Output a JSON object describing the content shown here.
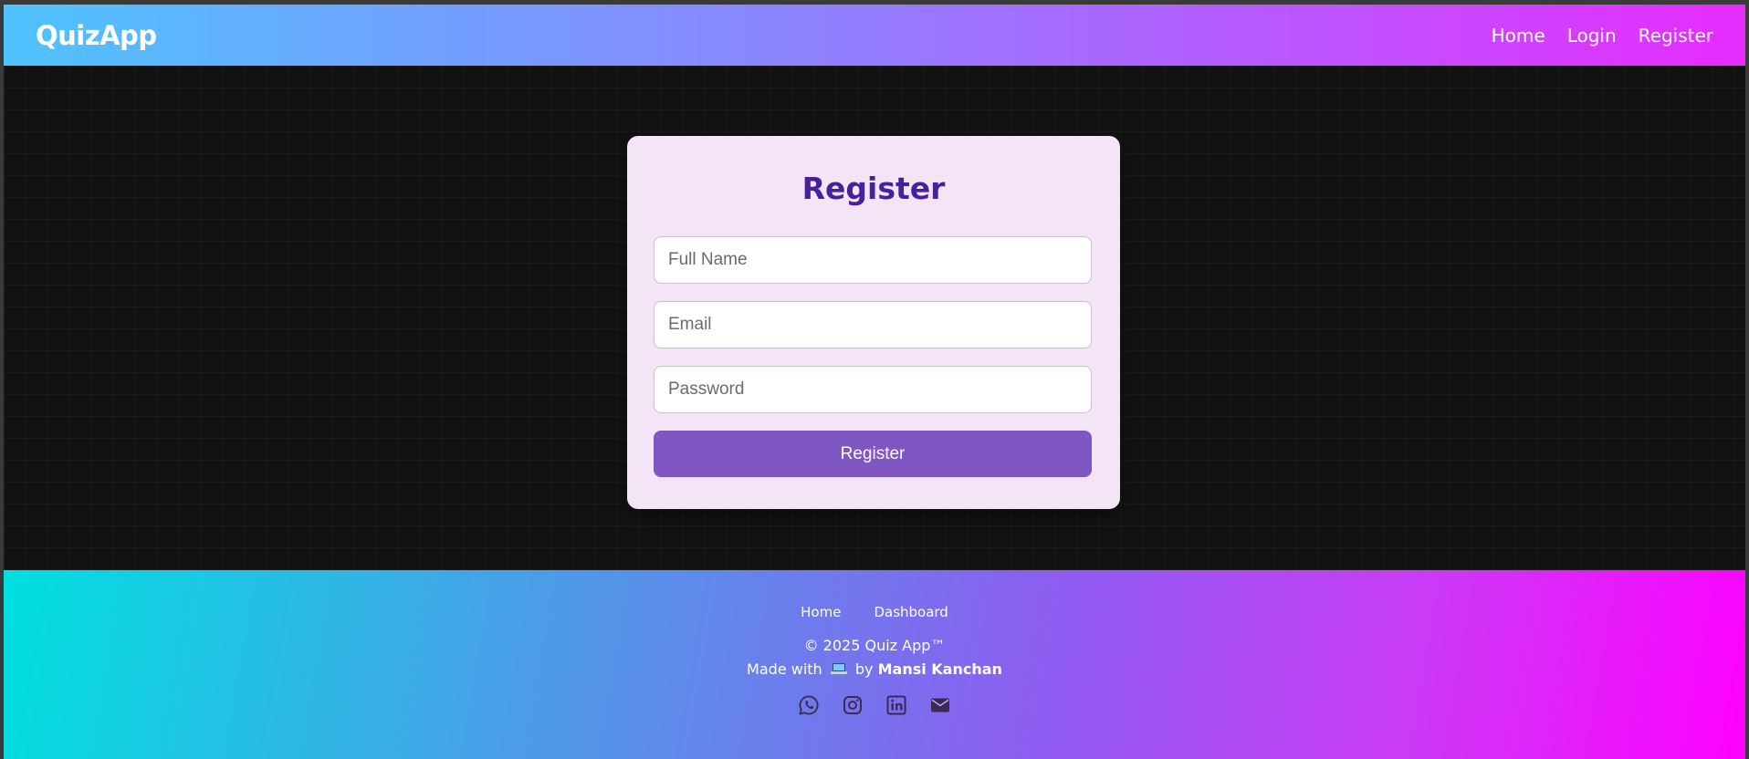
{
  "navbar": {
    "brand": "QuizApp",
    "links": [
      {
        "label": "Home"
      },
      {
        "label": "Login"
      },
      {
        "label": "Register"
      }
    ]
  },
  "register_card": {
    "title": "Register",
    "fields": {
      "full_name": {
        "placeholder": "Full Name",
        "value": ""
      },
      "email": {
        "placeholder": "Email",
        "value": ""
      },
      "password": {
        "placeholder": "Password",
        "value": ""
      }
    },
    "submit_label": "Register"
  },
  "footer": {
    "links": [
      {
        "label": "Home"
      },
      {
        "label": "Dashboard"
      }
    ],
    "copyright": "© 2025 Quiz App™",
    "made_with_prefix": "Made with",
    "made_with_by": "by",
    "author": "Mansi Kanchan",
    "socials": [
      {
        "icon": "whatsapp-icon"
      },
      {
        "icon": "instagram-icon"
      },
      {
        "icon": "linkedin-icon"
      },
      {
        "icon": "envelope-icon"
      }
    ]
  },
  "colors": {
    "card_bg": "#f3e5f5",
    "title": "#4a1f9e",
    "button": "#7e57c2",
    "social_icons": "#3a2a55"
  }
}
